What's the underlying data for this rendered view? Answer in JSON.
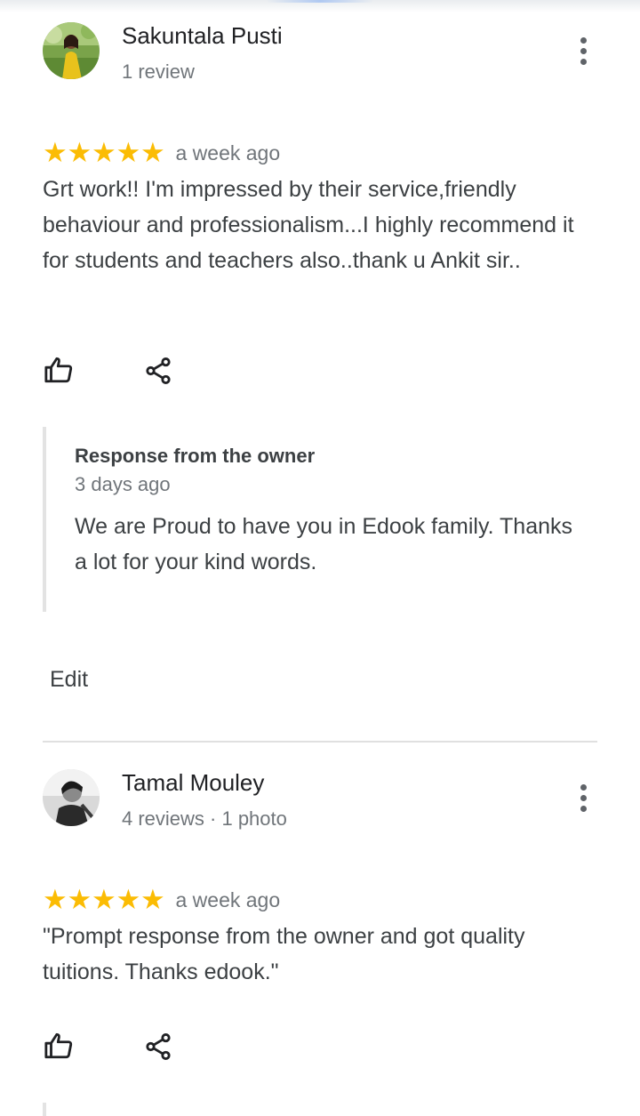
{
  "reviews": [
    {
      "reviewer_name": "Sakuntala Pusti",
      "reviewer_meta": "1 review",
      "rating": 5,
      "stars": "★★★★★",
      "time": "a week ago",
      "text": "Grt work!! I'm impressed by their service,friendly behaviour and professionalism...I highly recommend it for students and teachers also..thank u Ankit sir..",
      "owner_response": {
        "title": "Response from the owner",
        "time": "3 days ago",
        "text": "We are Proud to have you in Edook family. Thanks a lot for your kind words."
      },
      "edit_label": "Edit"
    },
    {
      "reviewer_name": "Tamal Mouley",
      "reviewer_meta": "4 reviews · 1 photo",
      "rating": 5,
      "stars": "★★★★★",
      "time": "a week ago",
      "text": "\"Prompt response from the owner and got quality tuitions. Thanks edook.\""
    }
  ],
  "icons": {
    "like": "thumbs-up-icon",
    "share": "share-icon",
    "more": "more-vert-icon"
  },
  "colors": {
    "star": "#fbbc04",
    "secondary_text": "#70757a",
    "primary_text": "#202124"
  }
}
